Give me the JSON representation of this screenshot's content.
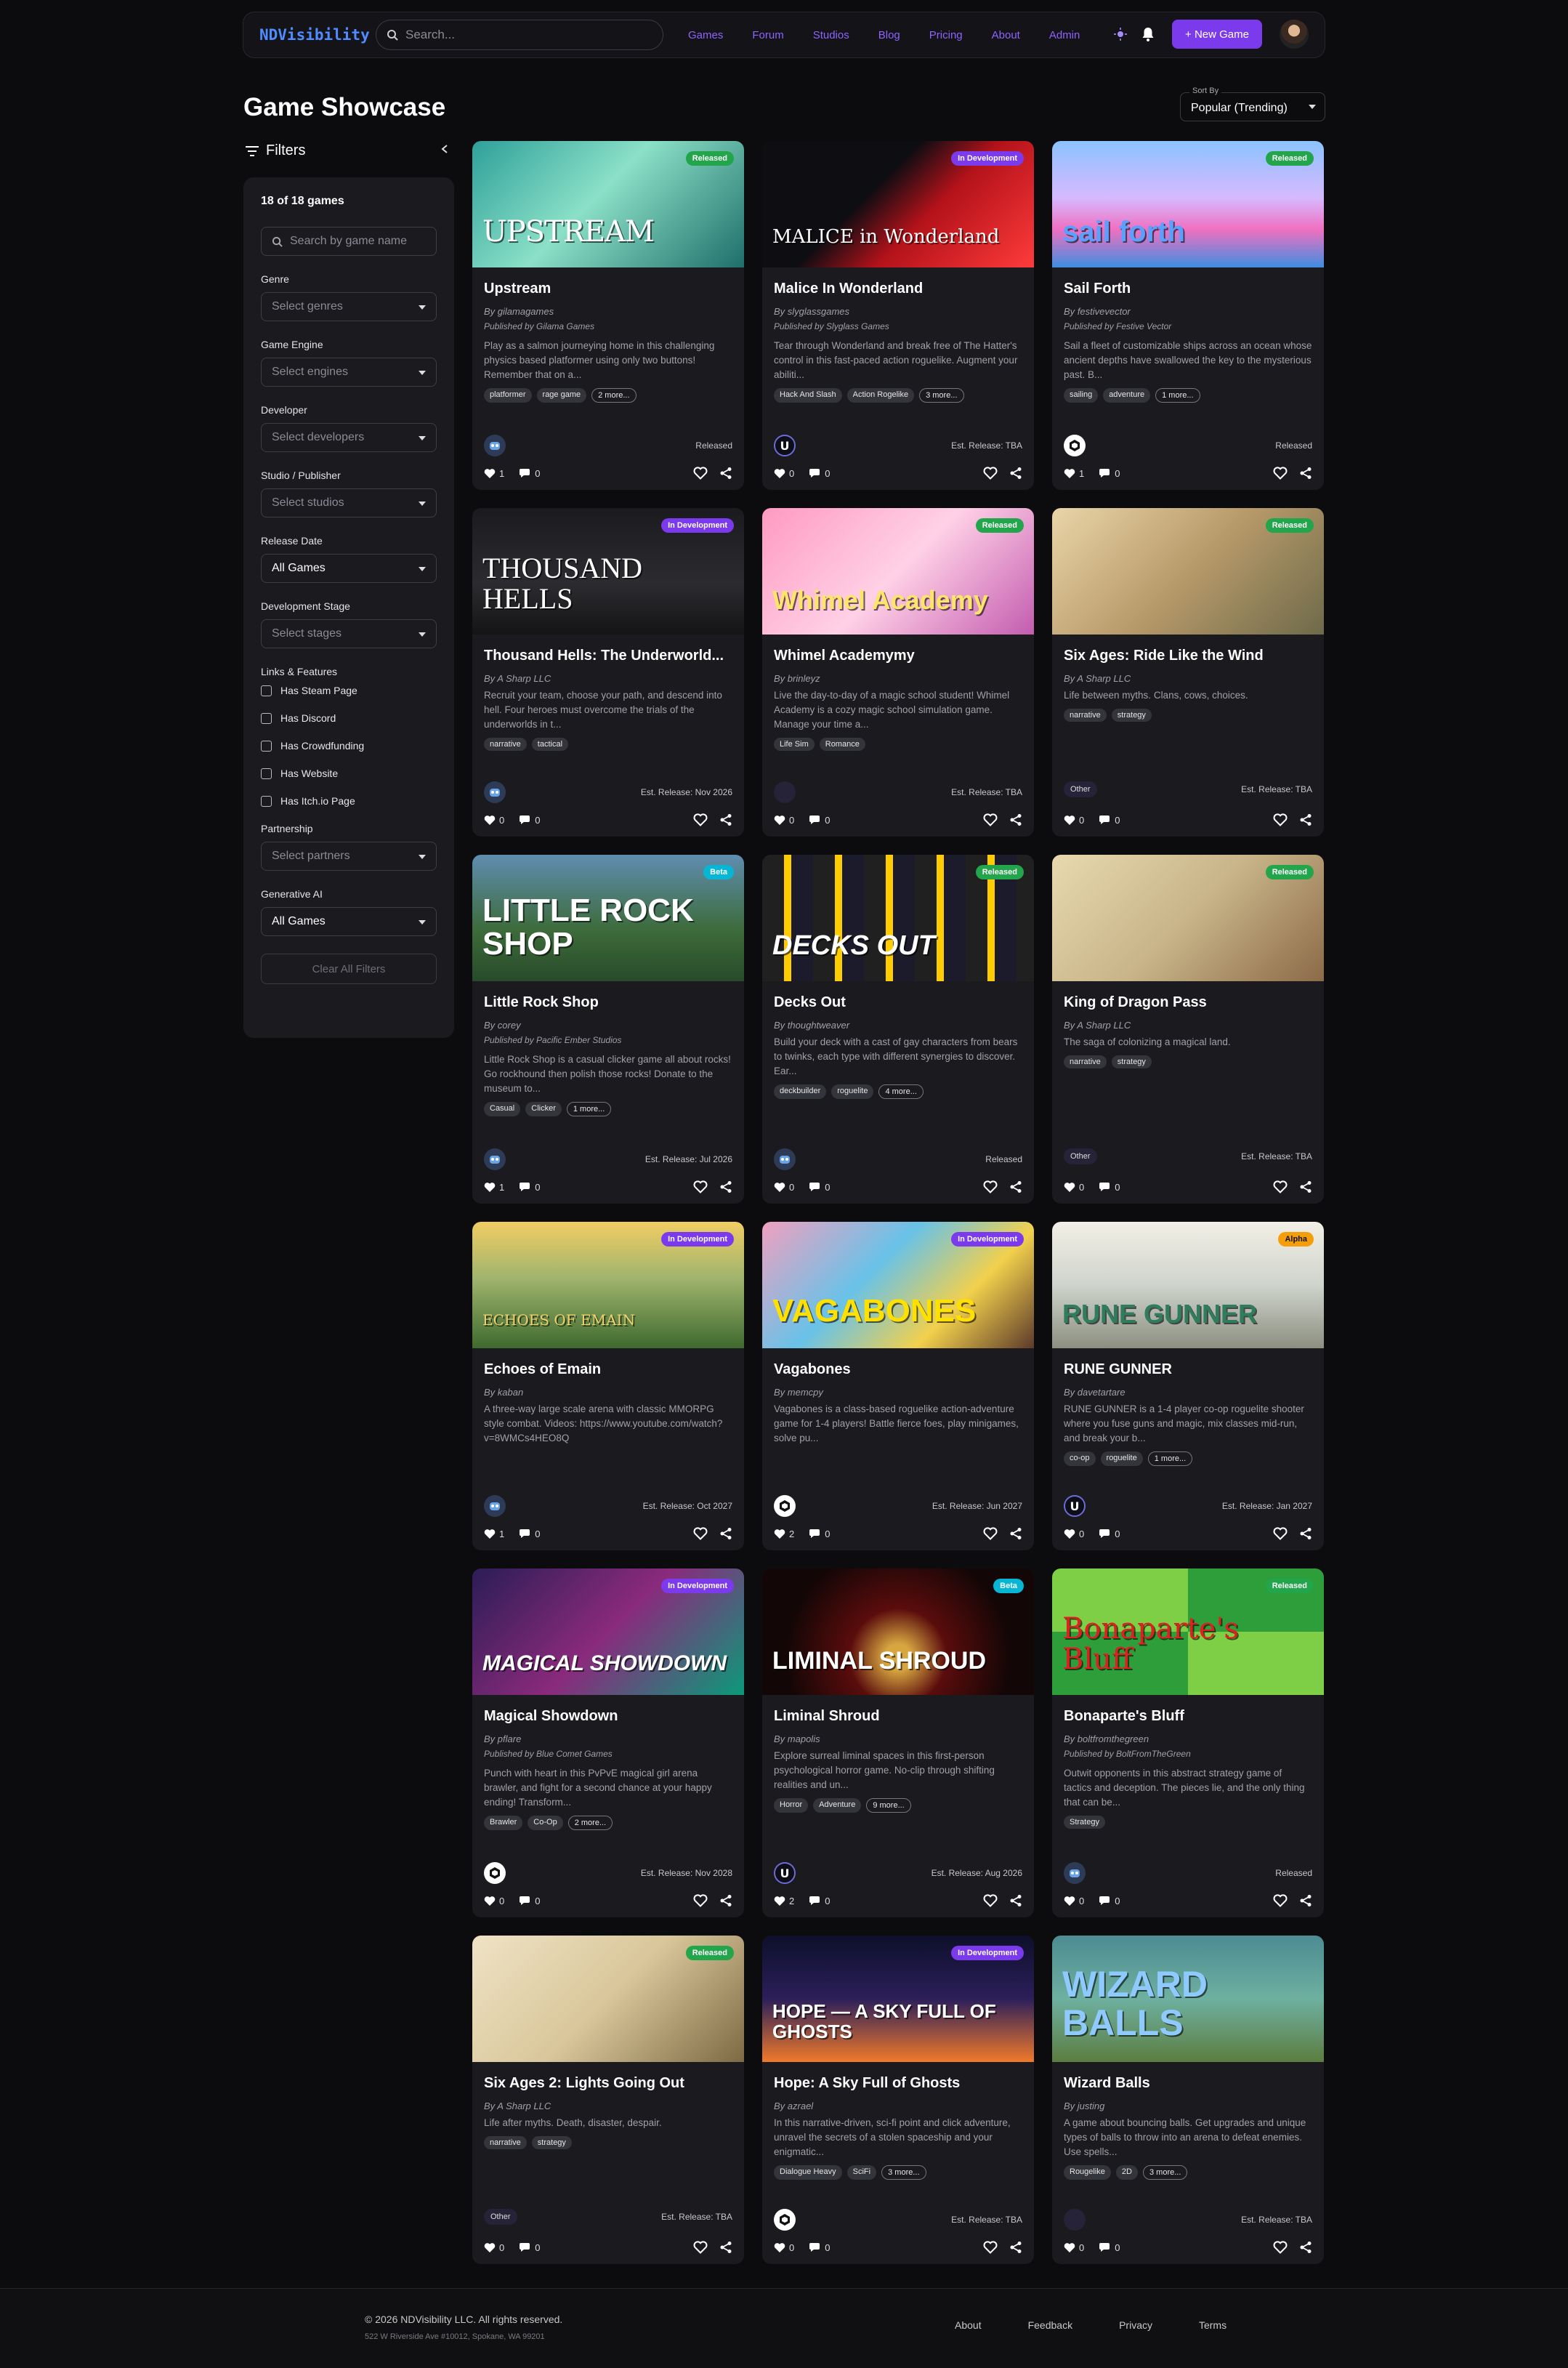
{
  "nav": {
    "logo": "NDVisibility",
    "search_placeholder": "Search...",
    "links": [
      "Games",
      "Forum",
      "Studios",
      "Blog",
      "Pricing",
      "About",
      "Admin"
    ],
    "new_game": "+ New Game"
  },
  "page": {
    "title": "Game Showcase",
    "sort_label": "Sort By",
    "sort_value": "Popular (Trending)"
  },
  "filters": {
    "heading": "Filters",
    "count": "18 of 18 games",
    "search_placeholder": "Search by game name",
    "genre": {
      "label": "Genre",
      "value": "Select genres"
    },
    "engine": {
      "label": "Game Engine",
      "value": "Select engines"
    },
    "developer": {
      "label": "Developer",
      "value": "Select developers"
    },
    "studio": {
      "label": "Studio / Publisher",
      "value": "Select studios"
    },
    "release": {
      "label": "Release Date",
      "value": "All Games"
    },
    "stage": {
      "label": "Development Stage",
      "value": "Select stages"
    },
    "links_label": "Links & Features",
    "checks": [
      "Has Steam Page",
      "Has Discord",
      "Has Crowdfunding",
      "Has Website",
      "Has Itch.io Page"
    ],
    "partnership": {
      "label": "Partnership",
      "value": "Select partners"
    },
    "genai": {
      "label": "Generative AI",
      "value": "All Games"
    },
    "clear": "Clear All Filters"
  },
  "games": [
    {
      "title": "Upstream",
      "badge": "Released",
      "by": "By gilamagames",
      "pub": "Published by Gilama Games",
      "desc": "Play as a salmon journeying home in this challenging physics based platformer using only two buttons! Remember that on a...",
      "tags": [
        "platformer",
        "rage game",
        "2 more..."
      ],
      "engine": "godot",
      "release": "Released",
      "likes": "1",
      "comments": "0"
    },
    {
      "title": "Malice In Wonderland",
      "badge": "In Development",
      "by": "By slyglassgames",
      "pub": "Published by Slyglass Games",
      "desc": "Tear through Wonderland and break free of The Hatter's control in this fast-paced action roguelike. Augment your abiliti...",
      "tags": [
        "Hack And Slash",
        "Action Rogelike",
        "3 more..."
      ],
      "engine": "unreal",
      "release": "Est. Release: TBA",
      "likes": "0",
      "comments": "0"
    },
    {
      "title": "Sail Forth",
      "badge": "Released",
      "by": "By festivevector",
      "pub": "Published by Festive Vector",
      "desc": "Sail a fleet of customizable ships across an ocean whose ancient depths have swallowed the key to the mysterious past. B...",
      "tags": [
        "sailing",
        "adventure",
        "1 more..."
      ],
      "engine": "unity",
      "release": "Released",
      "likes": "1",
      "comments": "0"
    },
    {
      "title": "Thousand Hells: The Underworld...",
      "badge": "In Development",
      "by": "By A Sharp LLC",
      "pub": "",
      "desc": "Recruit your team, choose your path, and descend into hell. Four heroes must overcome the trials of the underworlds in t...",
      "tags": [
        "narrative",
        "tactical"
      ],
      "engine": "godot",
      "release": "Est. Release: Nov 2026",
      "likes": "0",
      "comments": "0"
    },
    {
      "title": "Whimel Academymy",
      "badge": "Released",
      "by": "By brinleyz",
      "pub": "",
      "desc": "Live the day-to-day of a magic school student! Whimel Academy is a cozy magic school simulation game. Manage your time a...",
      "tags": [
        "Life Sim",
        "Romance"
      ],
      "engine": "none",
      "release": "Est. Release: TBA",
      "likes": "0",
      "comments": "0"
    },
    {
      "title": "Six Ages: Ride Like the Wind",
      "badge": "Released",
      "by": "By A Sharp LLC",
      "pub": "",
      "desc": "Life between myths. Clans, cows, choices.",
      "tags": [
        "narrative",
        "strategy"
      ],
      "engine": "other",
      "release": "Est. Release: TBA",
      "likes": "0",
      "comments": "0"
    },
    {
      "title": "Little Rock Shop",
      "badge": "Beta",
      "by": "By corey",
      "pub": "Published by Pacific Ember Studios",
      "desc": "Little Rock Shop is a casual clicker game all about rocks! Go rockhound then polish those rocks! Donate to the museum to...",
      "tags": [
        "Casual",
        "Clicker",
        "1 more..."
      ],
      "engine": "godot",
      "release": "Est. Release: Jul 2026",
      "likes": "1",
      "comments": "0"
    },
    {
      "title": "Decks Out",
      "badge": "Released",
      "by": "By thoughtweaver",
      "pub": "",
      "desc": "Build your deck with a cast of gay characters from bears to twinks, each type with different synergies to discover. Ear...",
      "tags": [
        "deckbuilder",
        "roguelite",
        "4 more..."
      ],
      "engine": "godot",
      "release": "Released",
      "likes": "0",
      "comments": "0"
    },
    {
      "title": "King of Dragon Pass",
      "badge": "Released",
      "by": "By A Sharp LLC",
      "pub": "",
      "desc": "The saga of colonizing a magical land.",
      "tags": [
        "narrative",
        "strategy"
      ],
      "engine": "other",
      "release": "Est. Release: TBA",
      "likes": "0",
      "comments": "0"
    },
    {
      "title": "Echoes of Emain",
      "badge": "In Development",
      "by": "By kaban",
      "pub": "",
      "desc": "A three-way large scale arena with classic MMORPG style combat. Videos: https://www.youtube.com/watch?v=8WMCs4HEO8Q",
      "tags": [],
      "engine": "godot",
      "release": "Est. Release: Oct 2027",
      "likes": "1",
      "comments": "0"
    },
    {
      "title": "Vagabones",
      "badge": "In Development",
      "by": "By memcpy",
      "pub": "",
      "desc": "Vagabones is a class-based roguelike action-adventure game for 1-4 players! Battle fierce foes, play minigames, solve pu...",
      "tags": [],
      "engine": "unity",
      "release": "Est. Release: Jun 2027",
      "likes": "2",
      "comments": "0"
    },
    {
      "title": "RUNE GUNNER",
      "badge": "Alpha",
      "by": "By davetartare",
      "pub": "",
      "desc": "RUNE GUNNER is a 1-4 player co-op roguelite shooter where you fuse guns and magic, mix classes mid-run, and break your b...",
      "tags": [
        "co-op",
        "roguelite",
        "1 more..."
      ],
      "engine": "unreal",
      "release": "Est. Release: Jan 2027",
      "likes": "0",
      "comments": "0"
    },
    {
      "title": "Magical Showdown",
      "badge": "In Development",
      "by": "By pflare",
      "pub": "Published by Blue Comet Games",
      "desc": "Punch with heart in this PvPvE magical girl arena brawler, and fight for a second chance at your happy ending! Transform...",
      "tags": [
        "Brawler",
        "Co-Op",
        "2 more..."
      ],
      "engine": "unity",
      "release": "Est. Release: Nov 2028",
      "likes": "0",
      "comments": "0"
    },
    {
      "title": "Liminal Shroud",
      "badge": "Beta",
      "by": "By mapolis",
      "pub": "",
      "desc": "Explore surreal liminal spaces in this first-person psychological horror game. No-clip through shifting realities and un...",
      "tags": [
        "Horror",
        "Adventure",
        "9 more..."
      ],
      "engine": "unreal",
      "release": "Est. Release: Aug 2026",
      "likes": "2",
      "comments": "0"
    },
    {
      "title": "Bonaparte's Bluff",
      "badge": "Released",
      "by": "By boltfromthegreen",
      "pub": "Published by BoltFromTheGreen",
      "desc": "Outwit opponents in this abstract strategy game of tactics and deception. The pieces lie, and the only thing that can be...",
      "tags": [
        "Strategy"
      ],
      "engine": "godot",
      "release": "Released",
      "likes": "0",
      "comments": "0"
    },
    {
      "title": "Six Ages 2: Lights Going Out",
      "badge": "Released",
      "by": "By A Sharp LLC",
      "pub": "",
      "desc": "Life after myths. Death, disaster, despair.",
      "tags": [
        "narrative",
        "strategy"
      ],
      "engine": "other",
      "release": "Est. Release: TBA",
      "likes": "0",
      "comments": "0"
    },
    {
      "title": "Hope: A Sky Full of Ghosts",
      "badge": "In Development",
      "by": "By azrael",
      "pub": "",
      "desc": "In this narrative-driven, sci-fi point and click adventure, unravel the secrets of a stolen spaceship and your enigmatic...",
      "tags": [
        "Dialogue Heavy",
        "SciFi",
        "3 more..."
      ],
      "engine": "unity",
      "release": "Est. Release: TBA",
      "likes": "0",
      "comments": "0"
    },
    {
      "title": "Wizard Balls",
      "badge": "",
      "by": "By justing",
      "pub": "",
      "desc": "A game about bouncing balls. Get upgrades and unique types of balls to throw into an arena to defeat enemies. Use spells...",
      "tags": [
        "Rougelike",
        "2D",
        "3 more..."
      ],
      "engine": "none",
      "release": "Est. Release: TBA",
      "likes": "0",
      "comments": "0"
    }
  ],
  "engine_other_label": "Other",
  "thumb_art": [
    "UPSTREAM",
    "MALICE in Wonderland",
    "sail forth",
    "THOUSAND HELLS",
    "Whimel Academy",
    "",
    "LITTLE ROCK SHOP",
    "DECKS OUT",
    "",
    "ECHOES OF EMAIN",
    "VAGABONES",
    "RUNE GUNNER",
    "MAGICAL SHOWDOWN",
    "LIMINAL SHROUD",
    "Bonaparte's Bluff",
    "",
    "HOPE — A SKY FULL OF GHOSTS",
    "WIZARD BALLS"
  ],
  "footer": {
    "copyright": "© 2026 NDVisibility LLC. All rights reserved.",
    "address": "522 W Riverside Ave #10012, Spokane, WA 99201",
    "links": [
      "About",
      "Feedback",
      "Privacy",
      "Terms"
    ]
  }
}
